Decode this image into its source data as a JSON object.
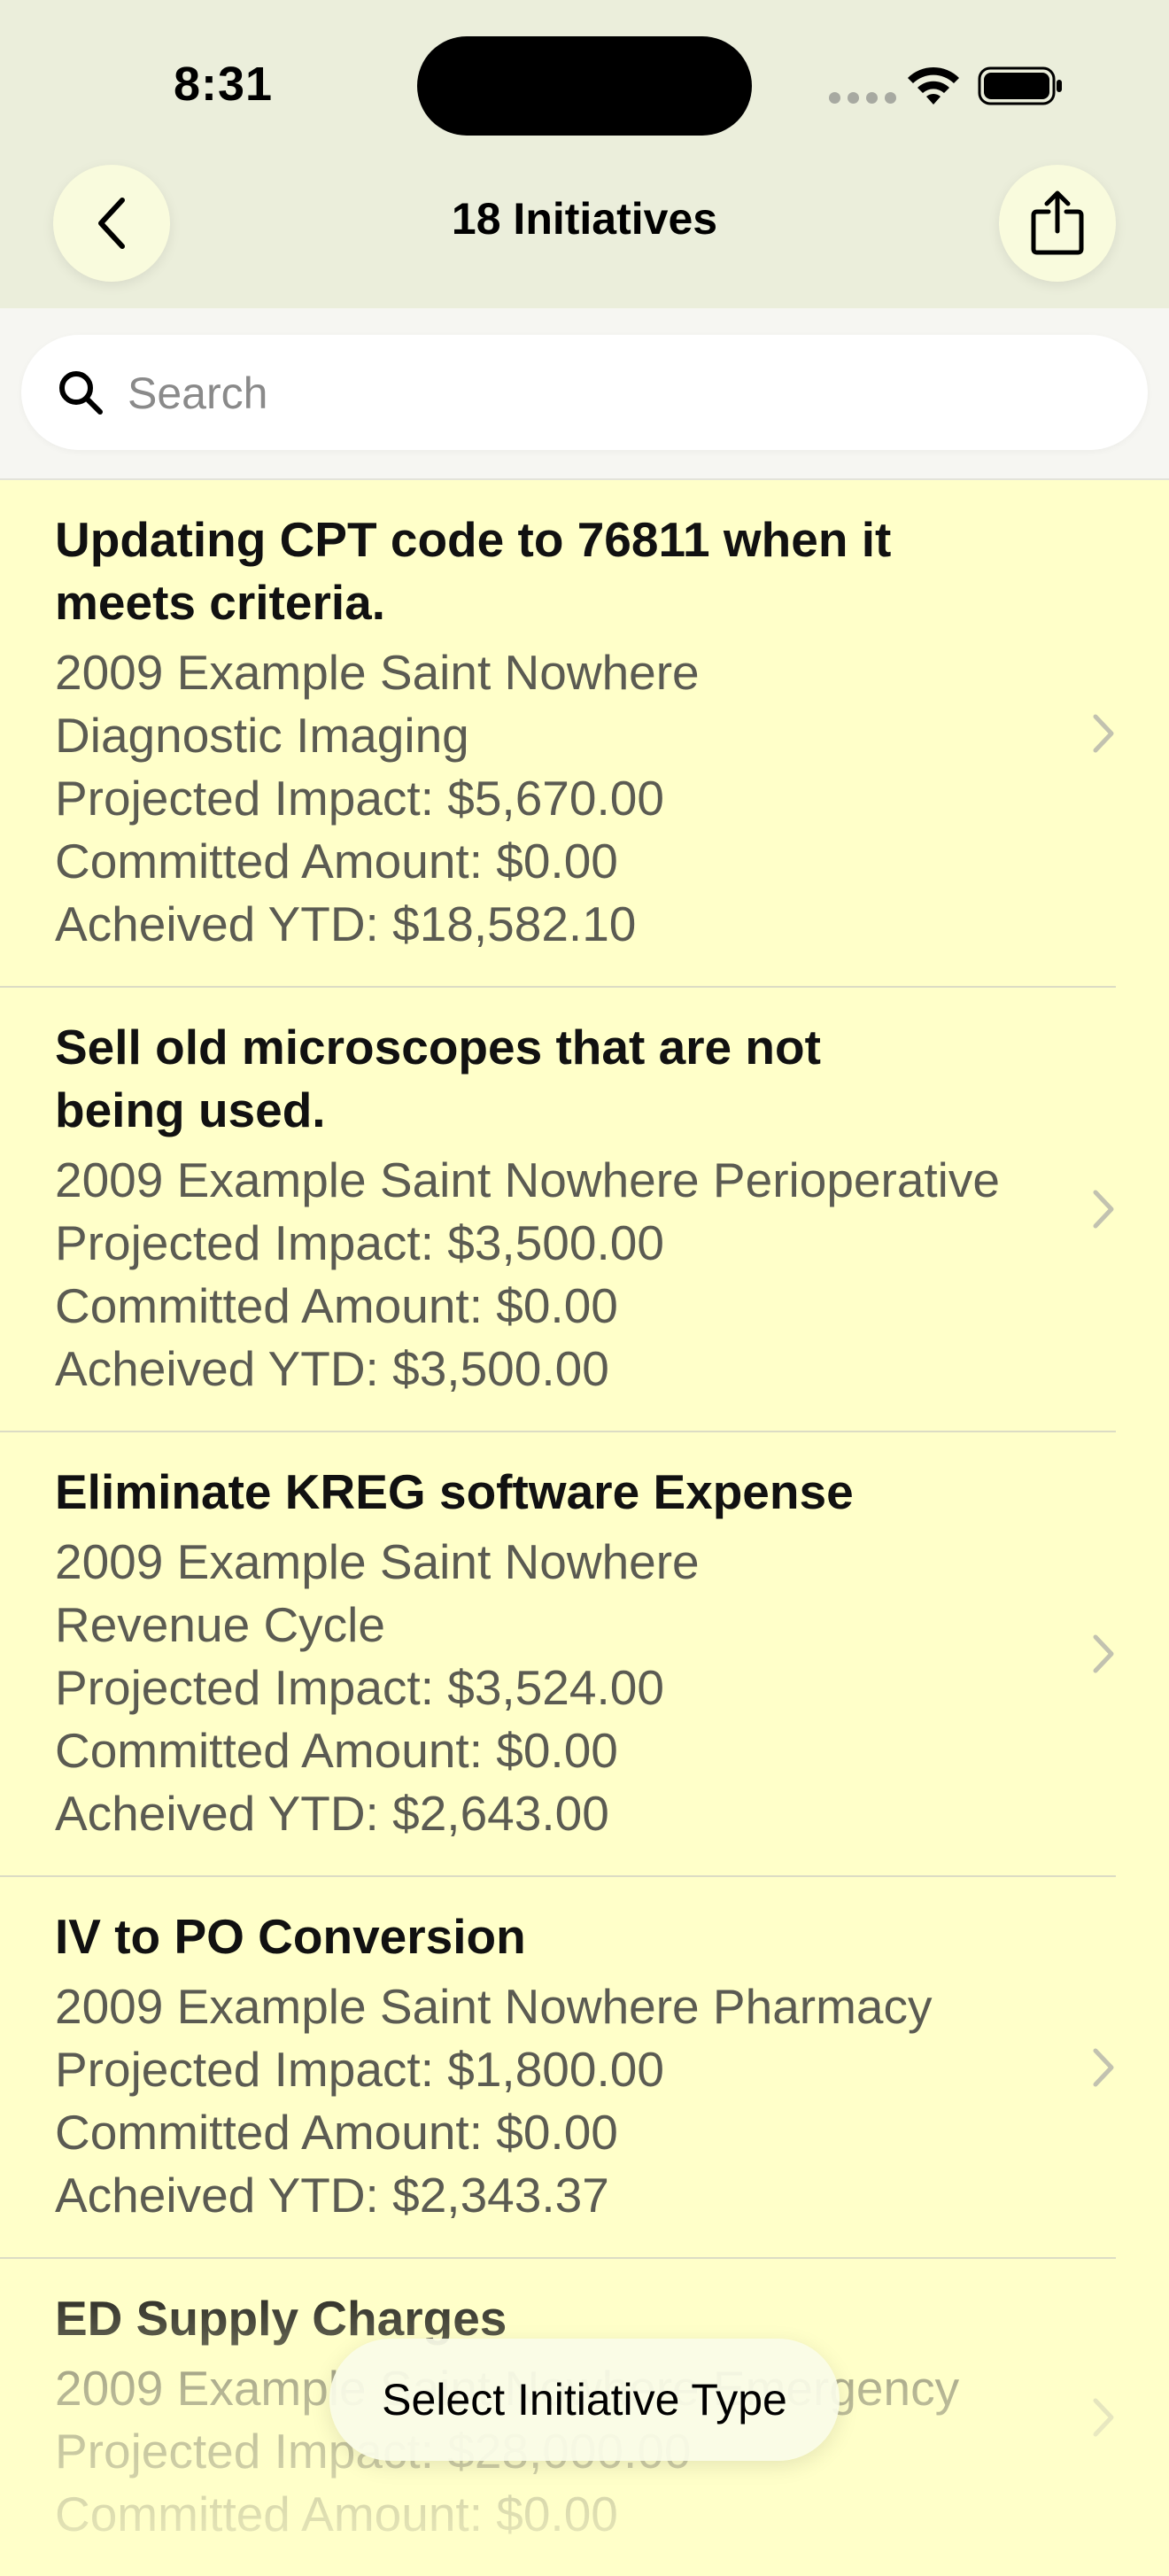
{
  "status_bar": {
    "time": "8:31"
  },
  "nav": {
    "title": "18 Initiatives",
    "back_icon": "chevron-left-icon",
    "share_icon": "share-icon"
  },
  "search": {
    "placeholder": "Search",
    "value": ""
  },
  "initiatives": [
    {
      "title": "Updating CPT code to 76811 when it meets criteria.",
      "lines": [
        "2009 Example Saint Nowhere",
        "Diagnostic Imaging",
        "Projected Impact: $5,670.00",
        "Committed Amount: $0.00",
        "Acheived YTD: $18,582.10"
      ]
    },
    {
      "title": "Sell old microscopes that are not being used.",
      "lines": [
        "2009 Example Saint Nowhere Perioperative",
        "Projected Impact: $3,500.00",
        "Committed Amount: $0.00",
        "Acheived YTD: $3,500.00"
      ]
    },
    {
      "title": "Eliminate KREG software Expense",
      "lines": [
        "2009 Example Saint Nowhere",
        "Revenue Cycle",
        "Projected Impact: $3,524.00",
        "Committed Amount: $0.00",
        "Acheived YTD: $2,643.00"
      ]
    },
    {
      "title": "IV to PO Conversion",
      "lines": [
        "2009 Example Saint Nowhere Pharmacy",
        "Projected Impact: $1,800.00",
        "Committed Amount: $0.00",
        "Acheived YTD: $2,343.37"
      ]
    },
    {
      "title": "ED Supply Charges",
      "lines": [
        "2009 Example Saint Nowhere Emergency",
        "Projected Impact: $28,000.00",
        "Committed Amount: $0.00"
      ]
    }
  ],
  "bottom_button": {
    "label": "Select Initiative Type"
  },
  "colors": {
    "header_bg": "#ebeedb",
    "list_bg": "#ffffc9",
    "secondary_text": "#5b5b52"
  }
}
